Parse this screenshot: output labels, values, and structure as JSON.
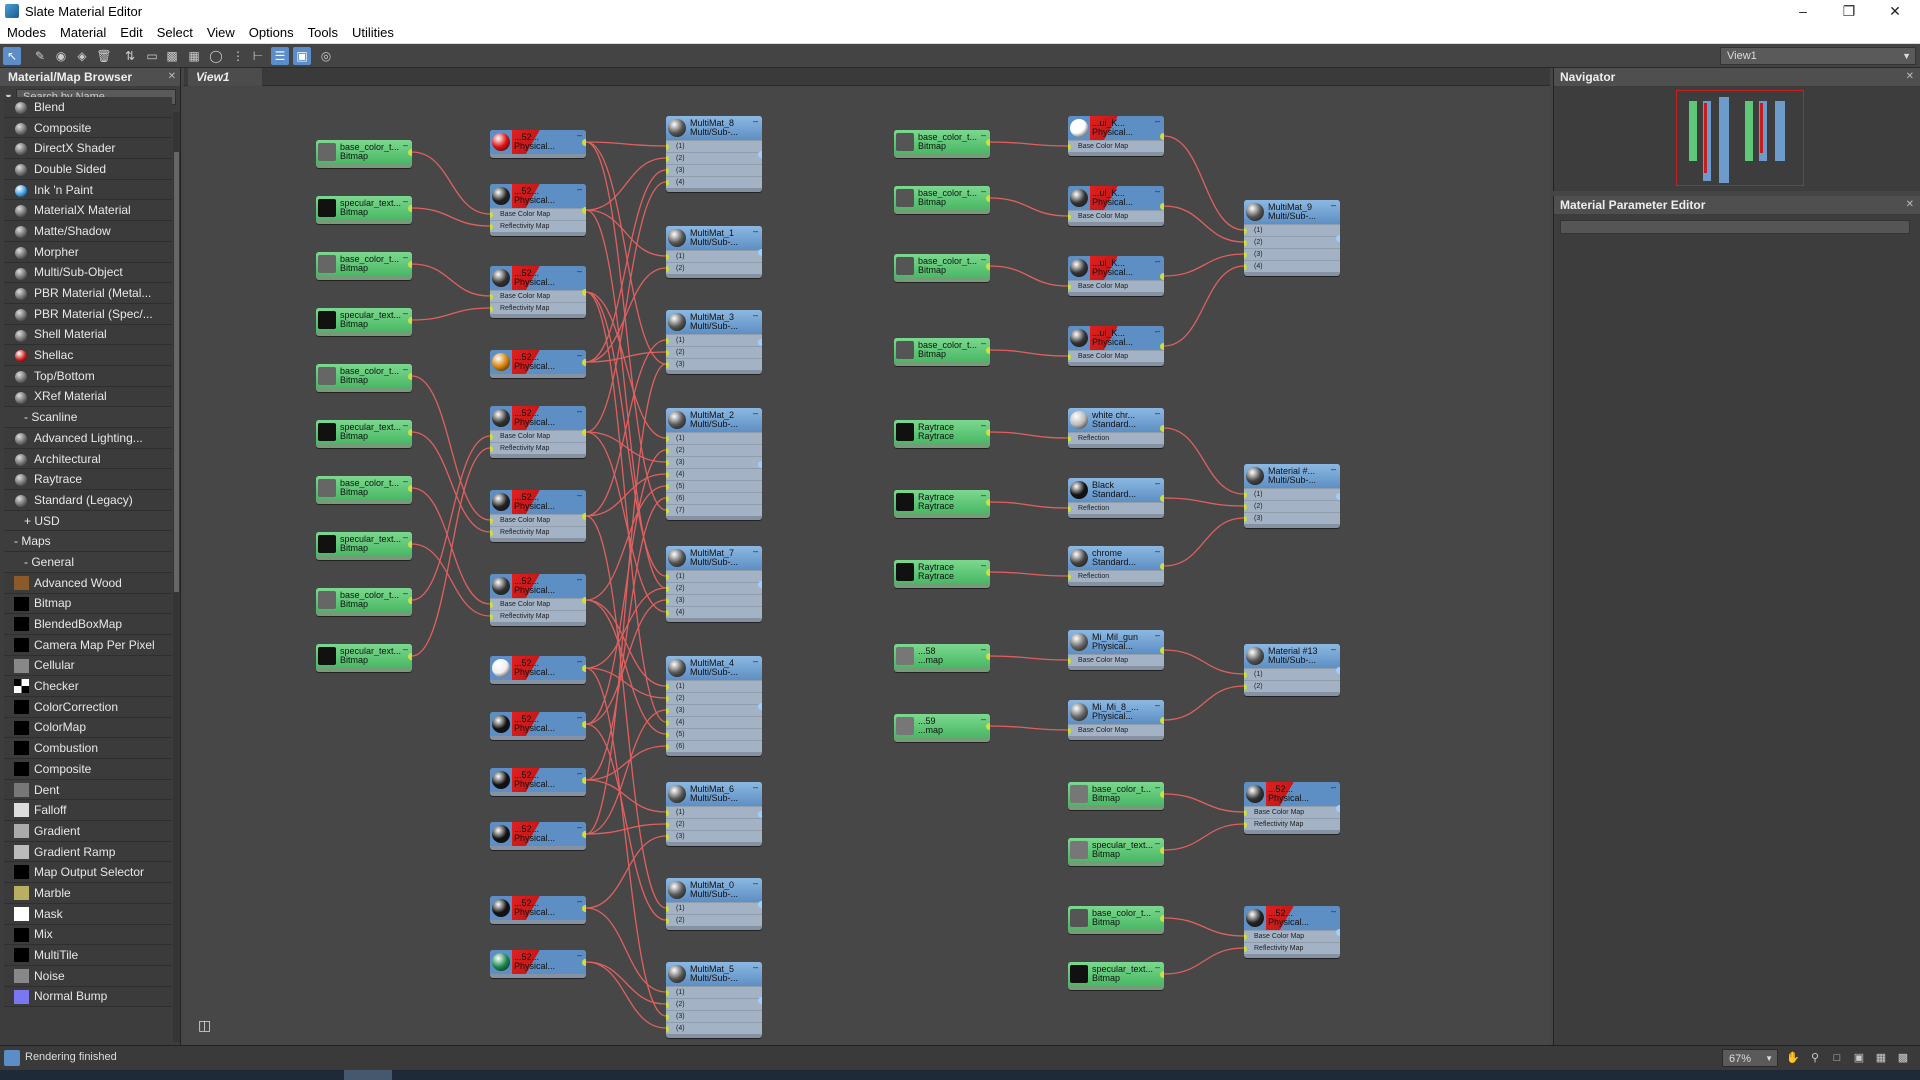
{
  "window": {
    "title": "Slate Material Editor"
  },
  "menu": [
    "Modes",
    "Material",
    "Edit",
    "Select",
    "View",
    "Options",
    "Tools",
    "Utilities"
  ],
  "toolbar": {
    "view_select": "View1"
  },
  "browser": {
    "title": "Material/Map Browser",
    "search_placeholder": "Search by Name ...",
    "items": [
      {
        "label": "Blend",
        "kind": "ball"
      },
      {
        "label": "Composite",
        "kind": "ball"
      },
      {
        "label": "DirectX Shader",
        "kind": "ball"
      },
      {
        "label": "Double Sided",
        "kind": "ball"
      },
      {
        "label": "Ink 'n Paint",
        "kind": "ball",
        "color": "#3a9ae0"
      },
      {
        "label": "MaterialX Material",
        "kind": "ball"
      },
      {
        "label": "Matte/Shadow",
        "kind": "ball"
      },
      {
        "label": "Morpher",
        "kind": "ball"
      },
      {
        "label": "Multi/Sub-Object",
        "kind": "ball"
      },
      {
        "label": "PBR Material (Metal...",
        "kind": "ball"
      },
      {
        "label": "PBR Material (Spec/...",
        "kind": "ball"
      },
      {
        "label": "Shell Material",
        "kind": "ball"
      },
      {
        "label": "Shellac",
        "kind": "ball",
        "color": "#cc1a1a"
      },
      {
        "label": "Top/Bottom",
        "kind": "ball"
      },
      {
        "label": "XRef Material",
        "kind": "ball"
      }
    ],
    "scanline_group": "- Scanline",
    "scanline_items": [
      {
        "label": "Advanced Lighting..."
      },
      {
        "label": "Architectural"
      },
      {
        "label": "Raytrace"
      },
      {
        "label": "Standard (Legacy)"
      }
    ],
    "usd_group": "+ USD",
    "maps_group": "- Maps",
    "general_group": "- General",
    "maps": [
      {
        "label": "Advanced Wood",
        "swatch": "#8a5a2a"
      },
      {
        "label": "Bitmap",
        "swatch": "#000"
      },
      {
        "label": "BlendedBoxMap",
        "swatch": "#000"
      },
      {
        "label": "Camera Map Per Pixel",
        "swatch": "#000"
      },
      {
        "label": "Cellular",
        "swatch": "#888"
      },
      {
        "label": "Checker",
        "swatch": "check"
      },
      {
        "label": "ColorCorrection",
        "swatch": "#000"
      },
      {
        "label": "ColorMap",
        "swatch": "#000"
      },
      {
        "label": "Combustion",
        "swatch": "#000"
      },
      {
        "label": "Composite",
        "swatch": "#000"
      },
      {
        "label": "Dent",
        "swatch": "#777"
      },
      {
        "label": "Falloff",
        "swatch": "#ddd"
      },
      {
        "label": "Gradient",
        "swatch": "#aaa"
      },
      {
        "label": "Gradient Ramp",
        "swatch": "#bbb"
      },
      {
        "label": "Map Output Selector",
        "swatch": "#000"
      },
      {
        "label": "Marble",
        "swatch": "#b8b060"
      },
      {
        "label": "Mask",
        "swatch": "#fff"
      },
      {
        "label": "Mix",
        "swatch": "#000"
      },
      {
        "label": "MultiTile",
        "swatch": "#000"
      },
      {
        "label": "Noise",
        "swatch": "#888"
      },
      {
        "label": "Normal Bump",
        "swatch": "#7a78f0"
      }
    ]
  },
  "view": {
    "tab": "View1"
  },
  "nodes": {
    "bitmap_a": {
      "t1": "base_color_t...",
      "t2": "Bitmap"
    },
    "bitmap_b": {
      "t1": "specular_text...",
      "t2": "Bitmap"
    },
    "phys": {
      "t1": "...52...",
      "t2": "Physical..."
    },
    "slot_base": "Base Color Map",
    "slot_refl": "Reflectivity Map",
    "slot_reflection": "Reflection",
    "multi": {
      "t2": "Multi/Sub-..."
    },
    "raytrace": {
      "t1": "Raytrace",
      "t2": "Raytrace"
    },
    "white_chr": {
      "t1": "white chr...",
      "t2": "Standard..."
    },
    "black": {
      "t1": "Black",
      "t2": "Standard..."
    },
    "chrome": {
      "t1": "chrome",
      "t2": "Standard..."
    },
    "mat_hash": {
      "t1": "Material #...",
      "t2": "Multi/Sub-..."
    },
    "mat13": {
      "t1": "Material #13",
      "t2": "Multi/Sub-..."
    },
    "mil_gun": {
      "t1": "Mi_Mil_gun",
      "t2": "Physical..."
    },
    "mil_8": {
      "t1": "Mi_Mi_8_...",
      "t2": "Physical..."
    },
    "phys_k": {
      "t1": "...ui_K...",
      "t2": "Physical..."
    },
    "bmp_58": {
      "t1": "...58",
      "t2": "...map"
    },
    "bmp_59": {
      "t1": "...59",
      "t2": "...map"
    },
    "multimat_labels": [
      "MultiMat_8",
      "MultiMat_1",
      "MultiMat_3",
      "MultiMat_2",
      "MultiMat_7",
      "MultiMat_4",
      "MultiMat_6",
      "MultiMat_0",
      "MultiMat_5",
      "MultiMat_9"
    ]
  },
  "navigator": {
    "title": "Navigator"
  },
  "param_editor": {
    "title": "Material Parameter Editor"
  },
  "status": {
    "text": "Rendering finished",
    "zoom": "67%"
  },
  "colors": {
    "bitmap_node": "#5fc878",
    "material_node": "#6d9ccc",
    "wire": "#e06060",
    "socket": "#c8e23a",
    "accent": "#5b8ec9"
  }
}
